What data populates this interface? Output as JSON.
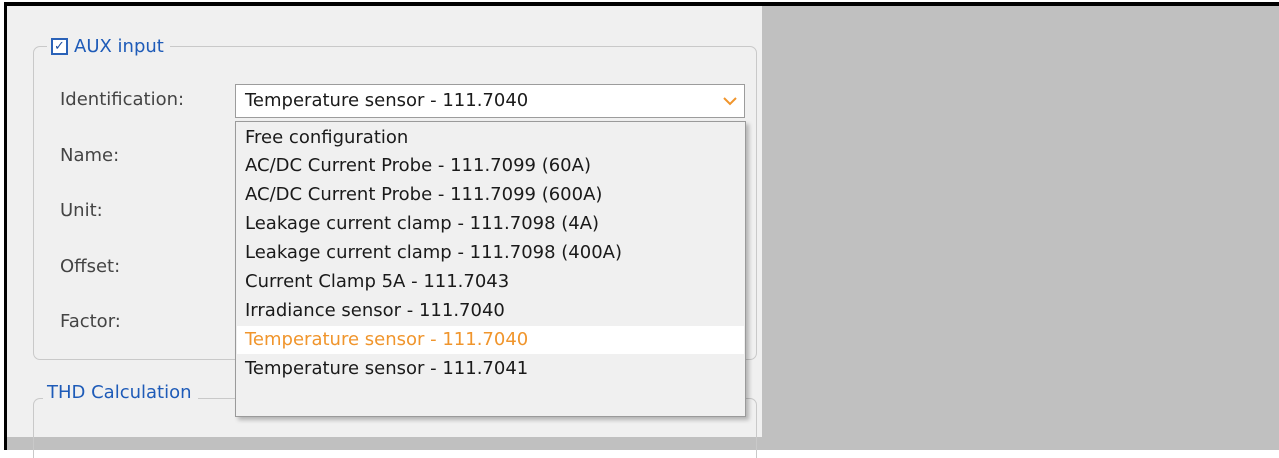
{
  "aux_group": {
    "enabled": true,
    "title": "AUX input",
    "labels": {
      "identification": "Identification:",
      "name": "Name:",
      "unit": "Unit:",
      "offset": "Offset:",
      "factor": "Factor:"
    },
    "identification": {
      "value": "Temperature sensor - 111.7040",
      "options": [
        "Free configuration",
        "AC/DC Current Probe - 111.7099 (60A)",
        "AC/DC Current Probe - 111.7099 (600A)",
        "Leakage current clamp - 111.7098 (4A)",
        "Leakage current clamp - 111.7098 (400A)",
        "Current Clamp 5A - 111.7043",
        "Irradiance sensor - 111.7040",
        "Temperature sensor - 111.7040",
        "Temperature sensor - 111.7041"
      ],
      "selected_index": 7
    }
  },
  "thd_group": {
    "title": "THD Calculation"
  },
  "colors": {
    "accent_orange": "#f0952c",
    "group_title_blue": "#1e5bb8"
  }
}
